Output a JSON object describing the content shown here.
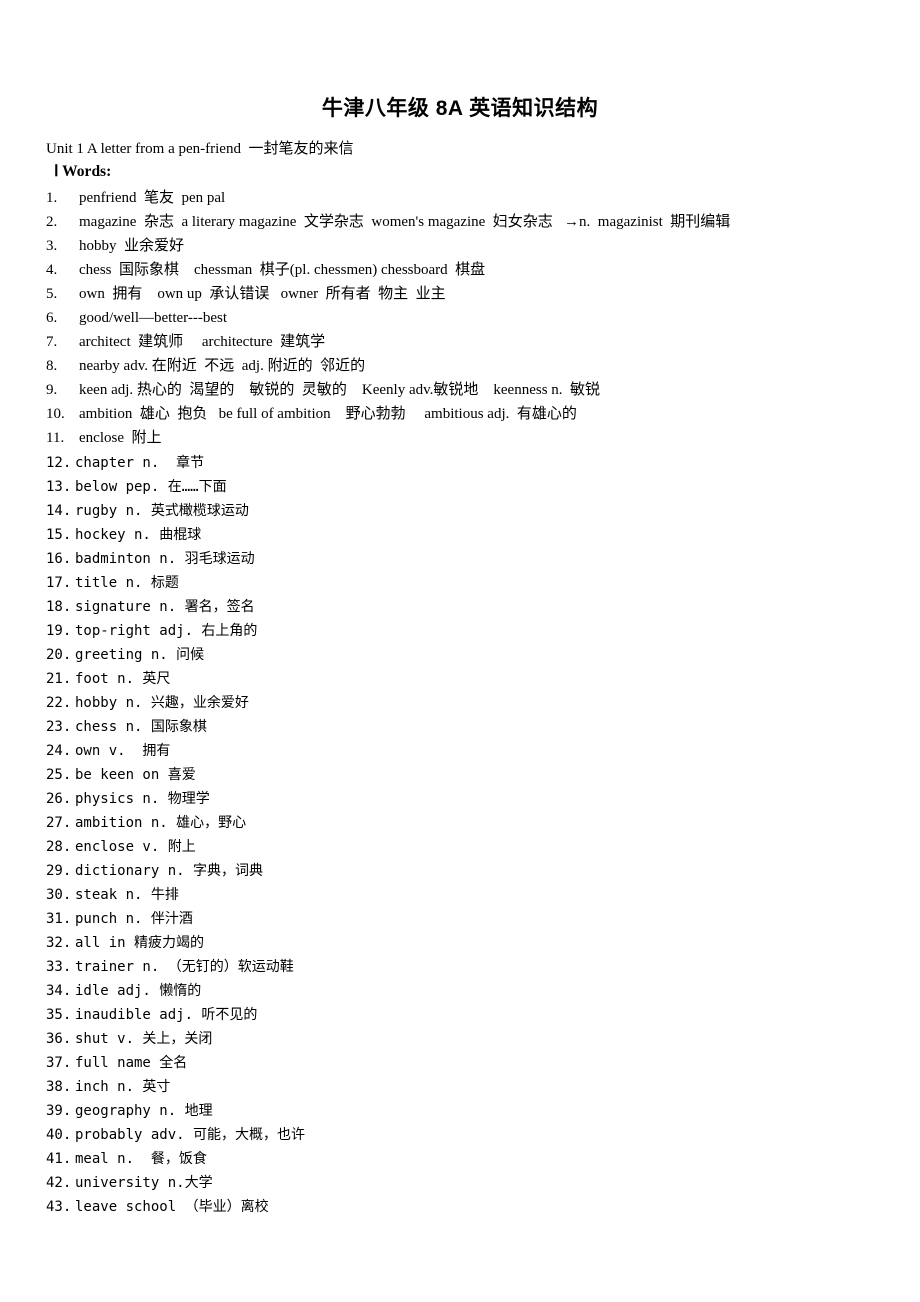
{
  "document": {
    "title": "牛津八年级 8A 英语知识结构",
    "unit_line": "Unit 1 A letter from a pen-friend  一封笔友的来信",
    "words_heading": "Ⅰ Words:"
  },
  "words": {
    "serif_items": [
      {
        "number": "1.",
        "text": "penfriend  笔友  pen pal"
      },
      {
        "number": "2.",
        "text": "magazine  杂志  a literary magazine  文学杂志  women's magazine  妇女杂志   →n.  magazinist  期刊编辑"
      },
      {
        "number": "3.",
        "text": "hobby  业余爱好"
      },
      {
        "number": "4.",
        "text": "chess  国际象棋    chessman  棋子(pl. chessmen) chessboard  棋盘"
      },
      {
        "number": "5.",
        "text": "own  拥有    own up  承认错误   owner  所有者  物主  业主"
      },
      {
        "number": "6.",
        "text": "good/well—better---best"
      },
      {
        "number": "7.",
        "text": "architect  建筑师     architecture  建筑学"
      },
      {
        "number": "8.",
        "text": "nearby adv. 在附近  不远  adj. 附近的  邻近的"
      },
      {
        "number": "9.",
        "text": "keen adj. 热心的  渴望的    敏锐的  灵敏的    Keenly adv.敏锐地    keenness n.  敏锐"
      },
      {
        "number": "10.",
        "text": "ambition  雄心  抱负   be full of ambition    野心勃勃     ambitious adj.  有雄心的"
      },
      {
        "number": "11.",
        "text": "enclose  附上"
      }
    ],
    "mono_items": [
      {
        "number": "12.",
        "text": "chapter n.  章节"
      },
      {
        "number": "13.",
        "text": "below pep. 在……下面"
      },
      {
        "number": "14.",
        "text": "rugby n. 英式橄榄球运动"
      },
      {
        "number": "15.",
        "text": "hockey n. 曲棍球"
      },
      {
        "number": "16.",
        "text": "badminton n. 羽毛球运动"
      },
      {
        "number": "17.",
        "text": "title n. 标题"
      },
      {
        "number": "18.",
        "text": "signature n. 署名，签名"
      },
      {
        "number": "19.",
        "text": "top-right adj. 右上角的"
      },
      {
        "number": "20.",
        "text": "greeting n. 问候"
      },
      {
        "number": "21.",
        "text": "foot n. 英尺"
      },
      {
        "number": "22.",
        "text": "hobby n. 兴趣，业余爱好"
      },
      {
        "number": "23.",
        "text": "chess n. 国际象棋"
      },
      {
        "number": "24.",
        "text": "own v.  拥有"
      },
      {
        "number": "25.",
        "text": "be keen on 喜爱"
      },
      {
        "number": "26.",
        "text": "physics n. 物理学"
      },
      {
        "number": "27.",
        "text": "ambition n. 雄心，野心"
      },
      {
        "number": "28.",
        "text": "enclose v. 附上"
      },
      {
        "number": "29.",
        "text": "dictionary n. 字典，词典"
      },
      {
        "number": "30.",
        "text": "steak n. 牛排"
      },
      {
        "number": "31.",
        "text": "punch n. 伴汁酒"
      },
      {
        "number": "32.",
        "text": "all in 精疲力竭的"
      },
      {
        "number": "33.",
        "text": "trainer n. （无钉的）软运动鞋"
      },
      {
        "number": "34.",
        "text": "idle adj. 懒惰的"
      },
      {
        "number": "35.",
        "text": "inaudible adj. 听不见的"
      },
      {
        "number": "36.",
        "text": "shut v. 关上，关闭"
      },
      {
        "number": "37.",
        "text": "full name 全名"
      },
      {
        "number": "38.",
        "text": "inch n. 英寸"
      },
      {
        "number": "39.",
        "text": "geography n. 地理"
      },
      {
        "number": "40.",
        "text": "probably adv. 可能，大概，也许"
      },
      {
        "number": "41.",
        "text": "meal n.  餐，饭食"
      },
      {
        "number": "42.",
        "text": "university n.大学"
      },
      {
        "number": "43.",
        "text": "leave school （毕业）离校"
      }
    ]
  }
}
